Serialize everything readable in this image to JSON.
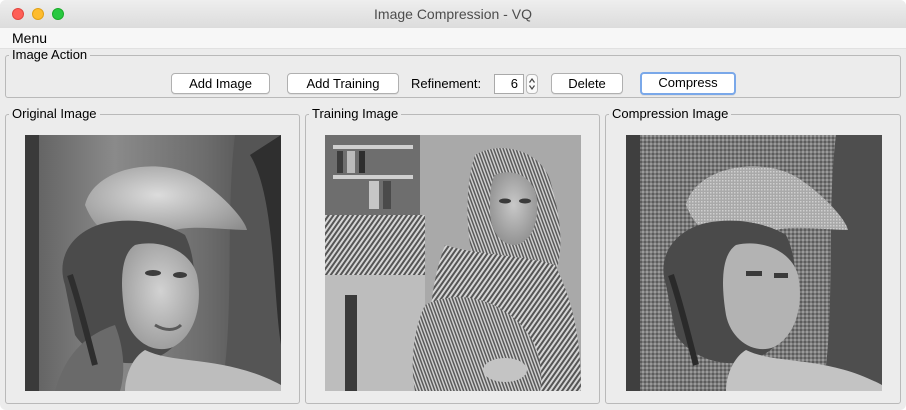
{
  "window": {
    "title": "Image Compression - VQ"
  },
  "menubar": {
    "menu_label": "Menu"
  },
  "actions": {
    "group_label": "Image Action",
    "add_image": "Add Image",
    "add_training": "Add Training",
    "refinement_label": "Refinement:",
    "refinement_value": "6",
    "delete": "Delete",
    "compress": "Compress"
  },
  "panels": {
    "original": {
      "label": "Original Image"
    },
    "training": {
      "label": "Training Image"
    },
    "compression": {
      "label": "Compression Image"
    }
  },
  "colors": {
    "tl_close": "#fe5f57",
    "tl_min": "#febc2e",
    "tl_max": "#28c840",
    "focus_ring": "#7aa8e9"
  },
  "icons": [
    "close-icon",
    "minimize-icon",
    "zoom-icon",
    "spinner-up-icon",
    "spinner-down-icon"
  ]
}
